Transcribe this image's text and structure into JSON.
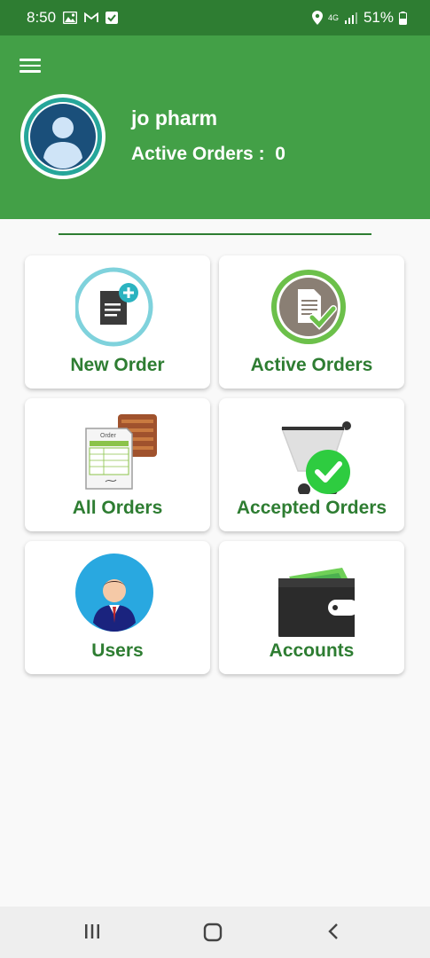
{
  "status_bar": {
    "time": "8:50",
    "network": "4G",
    "battery": "51%",
    "icons": [
      "gallery-icon",
      "gmail-icon",
      "check-box-icon",
      "location-icon",
      "signal-icon",
      "battery-icon"
    ]
  },
  "header": {
    "user_name": "jo pharm",
    "active_orders_label": "Active Orders :  0",
    "colors": {
      "header": "#43a047",
      "status_bar": "#2e7d32",
      "accent": "#2e7d32"
    }
  },
  "menu": {
    "new_order": "New Order",
    "active_orders": "Active Orders",
    "all_orders": "All Orders",
    "all_orders_icon_text": "Order",
    "accepted_orders": "Accepted Orders",
    "users": "Users",
    "accounts": "Accounts"
  },
  "nav": {
    "icons": [
      "recent-apps-icon",
      "home-icon",
      "back-icon"
    ]
  }
}
